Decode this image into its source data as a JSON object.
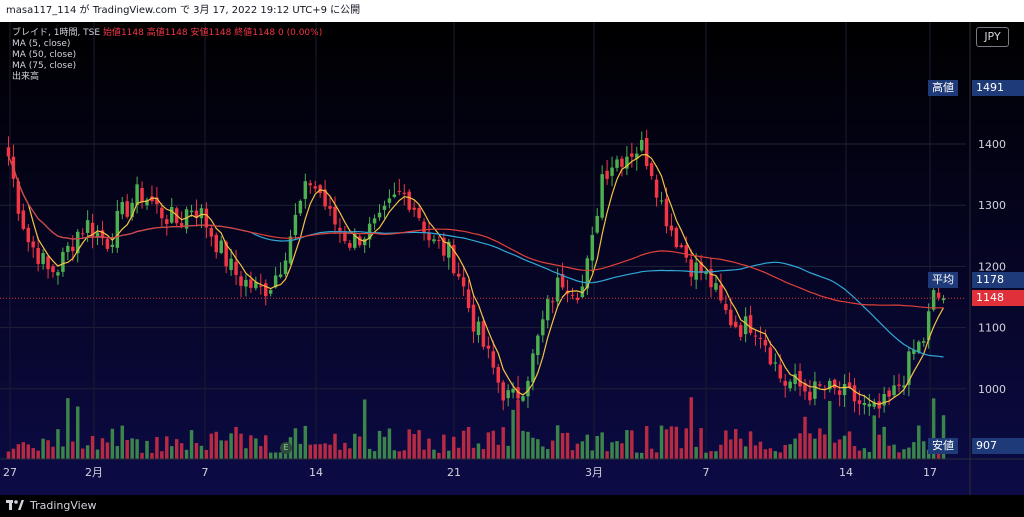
{
  "header": {
    "text": "masa117_114 が TradingView.com で 3月 17, 2022 19:12 UTC+9 に公開"
  },
  "legend": {
    "symbol": "ブレイド, 1時間, TSE",
    "ohlc_label": "始値1148 高値1148 安値1148 終値1148 0 (0.00%)",
    "ma5": "MA (5, close)",
    "ma50": "MA (50, close)",
    "ma75": "MA (75, close)",
    "volume": "出来高"
  },
  "currency": "JPY",
  "markers": {
    "high_label": "高値",
    "high_value": "1491",
    "avg_label": "平均",
    "avg_value": "1178",
    "current_value": "1148",
    "low_label": "安値",
    "low_value": "907",
    "earnings_icon": "E"
  },
  "colors": {
    "up": "#4caf50",
    "down": "#f23645",
    "ma5": "#f5c242",
    "ma50": "#30a8d8",
    "ma75": "#e0403a"
  },
  "footer": {
    "brand": "TradingView",
    "logo_icon": "tradingview-logo-icon"
  },
  "chart_data": {
    "type": "candlestick",
    "title": "",
    "price_axis": {
      "ticks": [
        1000,
        1100,
        1200,
        1300,
        1400
      ],
      "range": [
        907,
        1500
      ]
    },
    "time_axis": {
      "ticks": [
        "27",
        "2月",
        "7",
        "14",
        "21",
        "3月",
        "7",
        "14",
        "17"
      ]
    },
    "close_path": [
      1380,
      1300,
      1240,
      1220,
      1190,
      1200,
      1230,
      1260,
      1270,
      1250,
      1240,
      1280,
      1300,
      1320,
      1310,
      1290,
      1280,
      1270,
      1300,
      1290,
      1260,
      1230,
      1200,
      1180,
      1170,
      1160,
      1170,
      1200,
      1250,
      1300,
      1340,
      1320,
      1280,
      1260,
      1240,
      1250,
      1260,
      1270,
      1300,
      1320,
      1310,
      1280,
      1240,
      1230,
      1220,
      1180,
      1120,
      1080,
      1040,
      1000,
      980,
      1000,
      1040,
      1100,
      1150,
      1180,
      1170,
      1160,
      1230,
      1350,
      1370,
      1380,
      1390,
      1395,
      1360,
      1300,
      1260,
      1230,
      1200,
      1190,
      1170,
      1130,
      1110,
      1100,
      1110,
      1090,
      1050,
      1010,
      1010,
      1000,
      995,
      1000,
      995,
      990,
      985,
      970,
      960,
      970,
      990,
      1020,
      1060,
      1080,
      1150,
      1148
    ],
    "ma5": {
      "name": "MA (5, close)",
      "color": "#f5c242"
    },
    "ma50": {
      "name": "MA (50, close)",
      "color": "#30a8d8"
    },
    "ma75": {
      "name": "MA (75, close)",
      "color": "#e0403a"
    },
    "high": 1491,
    "average": 1178,
    "last": 1148,
    "low": 907,
    "currency": "JPY"
  }
}
